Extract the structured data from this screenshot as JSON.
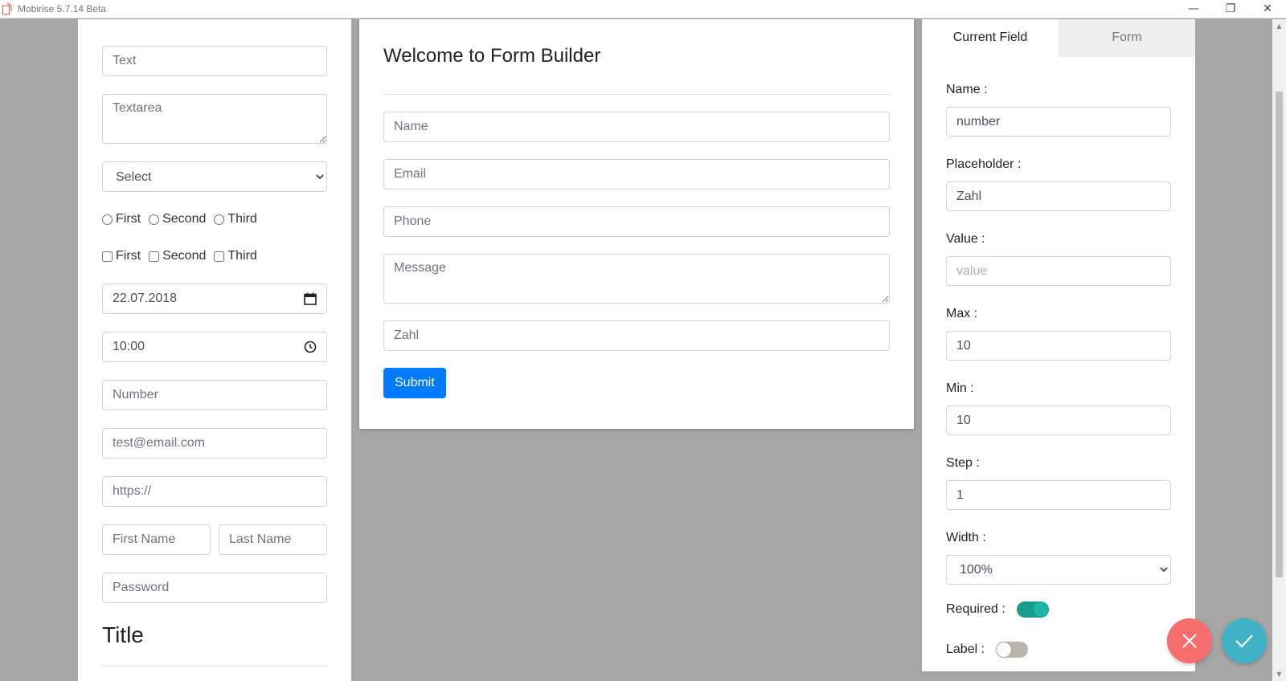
{
  "window": {
    "title": "Mobirise 5.7.14 Beta",
    "minimize_glyph": "—",
    "restore_glyph": "❐",
    "close_glyph": "✕"
  },
  "palette": {
    "text_placeholder": "Text",
    "textarea_placeholder": "Textarea",
    "select_value": "Select",
    "radios": [
      "First",
      "Second",
      "Third"
    ],
    "checkboxes": [
      "First",
      "Second",
      "Third"
    ],
    "date_value": "22.07.2018",
    "time_value": "10:00",
    "number_placeholder": "Number",
    "email_placeholder": "test@email.com",
    "url_placeholder": "https://",
    "first_name_placeholder": "First Name",
    "last_name_placeholder": "Last Name",
    "password_placeholder": "Password",
    "title": "Title"
  },
  "builder": {
    "title": "Welcome to Form Builder",
    "fields": {
      "name": "Name",
      "email": "Email",
      "phone": "Phone",
      "message": "Message",
      "zahl": "Zahl"
    },
    "submit_label": "Submit"
  },
  "settings": {
    "tabs": [
      "Current Field",
      "Form"
    ],
    "active_tab": "Current Field",
    "name_label": "Name :",
    "name_value": "number",
    "placeholder_label": "Placeholder :",
    "placeholder_value": "Zahl",
    "value_label": "Value :",
    "value_placeholder": "value",
    "max_label": "Max :",
    "max_value": "10",
    "min_label": "Min :",
    "min_value": "10",
    "step_label": "Step :",
    "step_value": "1",
    "width_label": "Width :",
    "width_value": "100%",
    "required_label": "Required :",
    "required_on": true,
    "label_label": "Label :",
    "label_on": false
  },
  "actions": {
    "cancel_icon": "close-icon",
    "confirm_icon": "check-icon"
  },
  "colors": {
    "accent_blue": "#007bff",
    "switch_on": "#149c8e",
    "fab_cancel": "#f66d6d",
    "fab_confirm": "#3fb2c5",
    "background": "#a5a5a5"
  }
}
